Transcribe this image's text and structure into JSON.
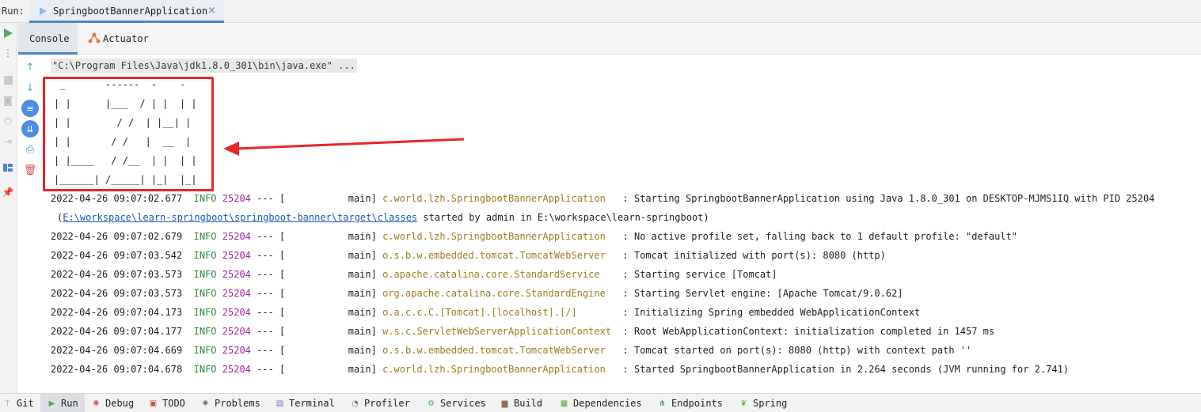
{
  "run_bar": {
    "label": "Run:",
    "tab_title": "SpringbootBannerApplication",
    "tab_close": "×"
  },
  "sub_tabs": {
    "console": "Console",
    "actuator": "Actuator"
  },
  "console": {
    "command": "\"C:\\Program Files\\Java\\jdk1.8.0_301\\bin\\java.exe\" ...",
    "banner": [
      " _       ------  -    -",
      "| |      |___  / | |  | |",
      "| |        / /  | |__| |",
      "| |       / /   |  __  |",
      "| |____   / /__  | |  | |",
      "|______| /_____| |_|  |_|"
    ],
    "logs": [
      {
        "ts": "2022-04-26 09:07:02.677",
        "level": "INFO",
        "pid": "25204",
        "sep": "--- [",
        "thread": "           main]",
        "logger": "c.world.lzh.SpringbootBannerApplication  ",
        "msg": ": Starting SpringbootBannerApplication using Java 1.8.0_301 on DESKTOP-MJMS1IQ with PID 25204"
      },
      {
        "ts": "2022-04-26 09:07:02.679",
        "level": "INFO",
        "pid": "25204",
        "sep": "--- [",
        "thread": "           main]",
        "logger": "c.world.lzh.SpringbootBannerApplication  ",
        "msg": ": No active profile set, falling back to 1 default profile: \"default\""
      },
      {
        "ts": "2022-04-26 09:07:03.542",
        "level": "INFO",
        "pid": "25204",
        "sep": "--- [",
        "thread": "           main]",
        "logger": "o.s.b.w.embedded.tomcat.TomcatWebServer  ",
        "msg": ": Tomcat initialized with port(s): 8080 (http)"
      },
      {
        "ts": "2022-04-26 09:07:03.573",
        "level": "INFO",
        "pid": "25204",
        "sep": "--- [",
        "thread": "           main]",
        "logger": "o.apache.catalina.core.StandardService   ",
        "msg": ": Starting service [Tomcat]"
      },
      {
        "ts": "2022-04-26 09:07:03.573",
        "level": "INFO",
        "pid": "25204",
        "sep": "--- [",
        "thread": "           main]",
        "logger": "org.apache.catalina.core.StandardEngine  ",
        "msg": ": Starting Servlet engine: [Apache Tomcat/9.0.62]"
      },
      {
        "ts": "2022-04-26 09:07:04.173",
        "level": "INFO",
        "pid": "25204",
        "sep": "--- [",
        "thread": "           main]",
        "logger": "o.a.c.c.C.[Tomcat].[localhost].[/]       ",
        "msg": ": Initializing Spring embedded WebApplicationContext"
      },
      {
        "ts": "2022-04-26 09:07:04.177",
        "level": "INFO",
        "pid": "25204",
        "sep": "--- [",
        "thread": "           main]",
        "logger": "w.s.c.ServletWebServerApplicationContext ",
        "msg": ": Root WebApplicationContext: initialization completed in 1457 ms"
      },
      {
        "ts": "2022-04-26 09:07:04.669",
        "level": "INFO",
        "pid": "25204",
        "sep": "--- [",
        "thread": "           main]",
        "logger": "o.s.b.w.embedded.tomcat.TomcatWebServer  ",
        "msg": ": Tomcat started on port(s): 8080 (http) with context path ''"
      },
      {
        "ts": "2022-04-26 09:07:04.678",
        "level": "INFO",
        "pid": "25204",
        "sep": "--- [",
        "thread": "           main]",
        "logger": "c.world.lzh.SpringbootBannerApplication  ",
        "msg": ": Started SpringbootBannerApplication in 2.264 seconds (JVM running for 2.741)"
      }
    ],
    "continuation": {
      "prefix": "(",
      "link": "E:\\workspace\\learn-springboot\\springboot-banner\\target\\classes",
      "suffix": " started by admin in E:\\workspace\\learn-springboot)"
    }
  },
  "bottom_tabs": [
    {
      "label": "Git",
      "icon": "git-branch-icon",
      "color": "#4a88c7"
    },
    {
      "label": "Run",
      "icon": "run-icon",
      "color": "#4caf50"
    },
    {
      "label": "Debug",
      "icon": "bug-icon",
      "color": "#d9534f"
    },
    {
      "label": "TODO",
      "icon": "todo-icon",
      "color": "#c0504d"
    },
    {
      "label": "Problems",
      "icon": "problems-icon",
      "color": "#7a7a7a"
    },
    {
      "label": "Terminal",
      "icon": "terminal-icon",
      "color": "#8a6bbf"
    },
    {
      "label": "Profiler",
      "icon": "profiler-icon",
      "color": "#666666"
    },
    {
      "label": "Services",
      "icon": "services-icon",
      "color": "#4caf50"
    },
    {
      "label": "Build",
      "icon": "build-icon",
      "color": "#8d6e63"
    },
    {
      "label": "Dependencies",
      "icon": "dependencies-icon",
      "color": "#5a9e3a"
    },
    {
      "label": "Endpoints",
      "icon": "endpoints-icon",
      "color": "#2e7d32"
    },
    {
      "label": "Spring",
      "icon": "spring-leaf-icon",
      "color": "#6db33f"
    }
  ],
  "colors": {
    "accent": "#4a88c7",
    "highlight": "#e8262b",
    "info": "#2e8b3e",
    "pid": "#a1259c",
    "logger": "#9a7c1e",
    "link": "#1a57b4"
  }
}
